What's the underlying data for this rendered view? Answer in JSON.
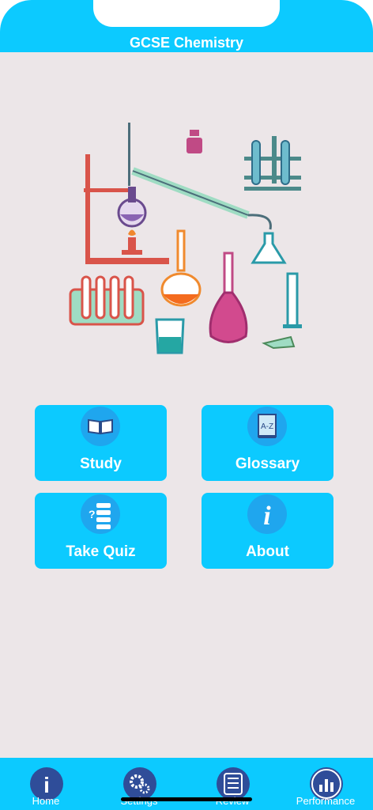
{
  "header": {
    "title": "GCSE Chemistry"
  },
  "menu": {
    "study": "Study",
    "glossary": "Glossary",
    "glossary_icon_text": "A-Z",
    "take_quiz": "Take Quiz",
    "about": "About",
    "about_icon_text": "i",
    "quiz_icon_text": "?"
  },
  "tabbar": {
    "home": "Home",
    "settings": "Settings",
    "review": "Review",
    "performance": "Performance",
    "home_icon_text": "i"
  },
  "colors": {
    "accent": "#0ccaff",
    "tab_icon": "#2f4d99",
    "background": "#ece6e8"
  }
}
